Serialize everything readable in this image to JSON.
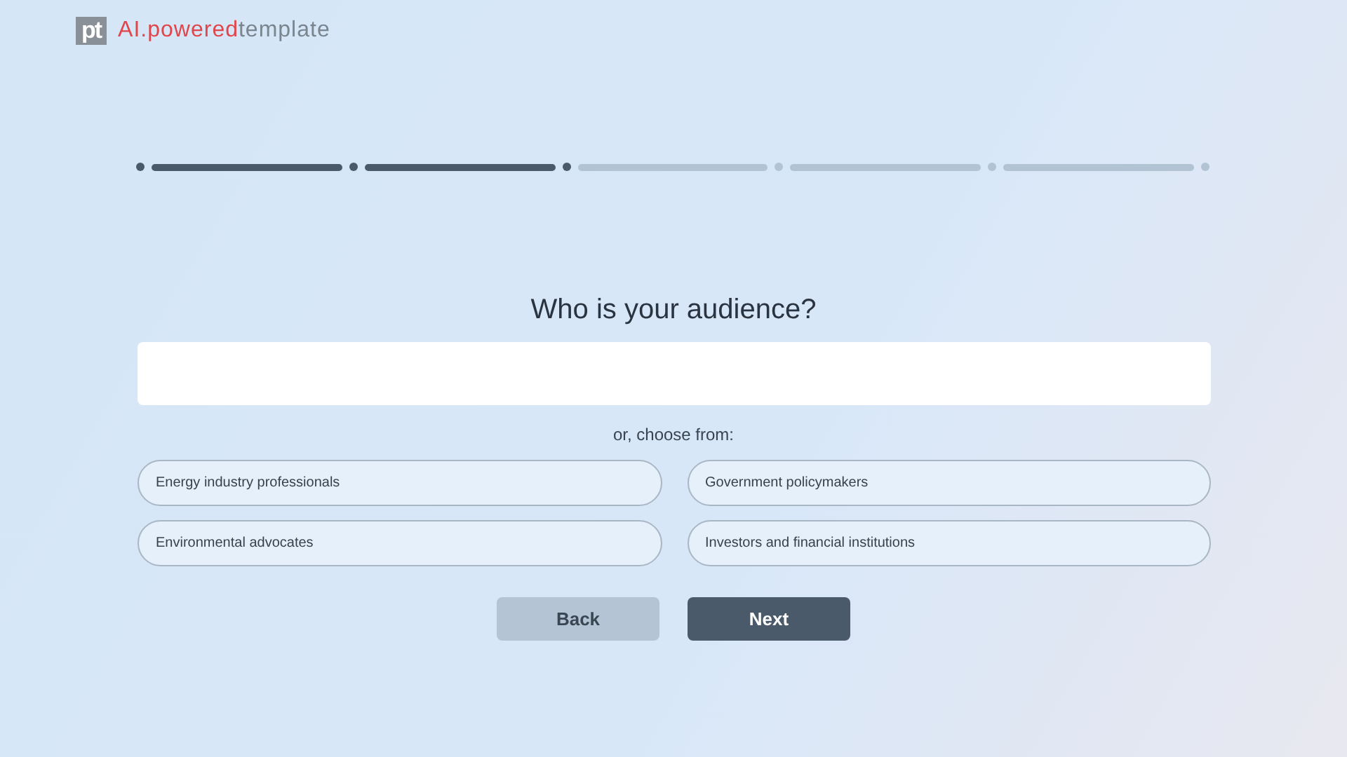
{
  "logo": {
    "mark": "pt",
    "brand_accent": "AI.powered",
    "brand_rest": "template"
  },
  "progress": {
    "steps": [
      {
        "done": true
      },
      {
        "done": true
      },
      {
        "done": false
      },
      {
        "done": false
      },
      {
        "done": false
      }
    ]
  },
  "question": "Who is your audience?",
  "choose_label": "or, choose from:",
  "choices": [
    "Energy industry professionals",
    "Government policymakers",
    "Environmental advocates",
    "Investors and financial institutions"
  ],
  "buttons": [
    {
      "label": "Back",
      "kind": "secondary"
    },
    {
      "label": "Next",
      "kind": "primary"
    }
  ]
}
